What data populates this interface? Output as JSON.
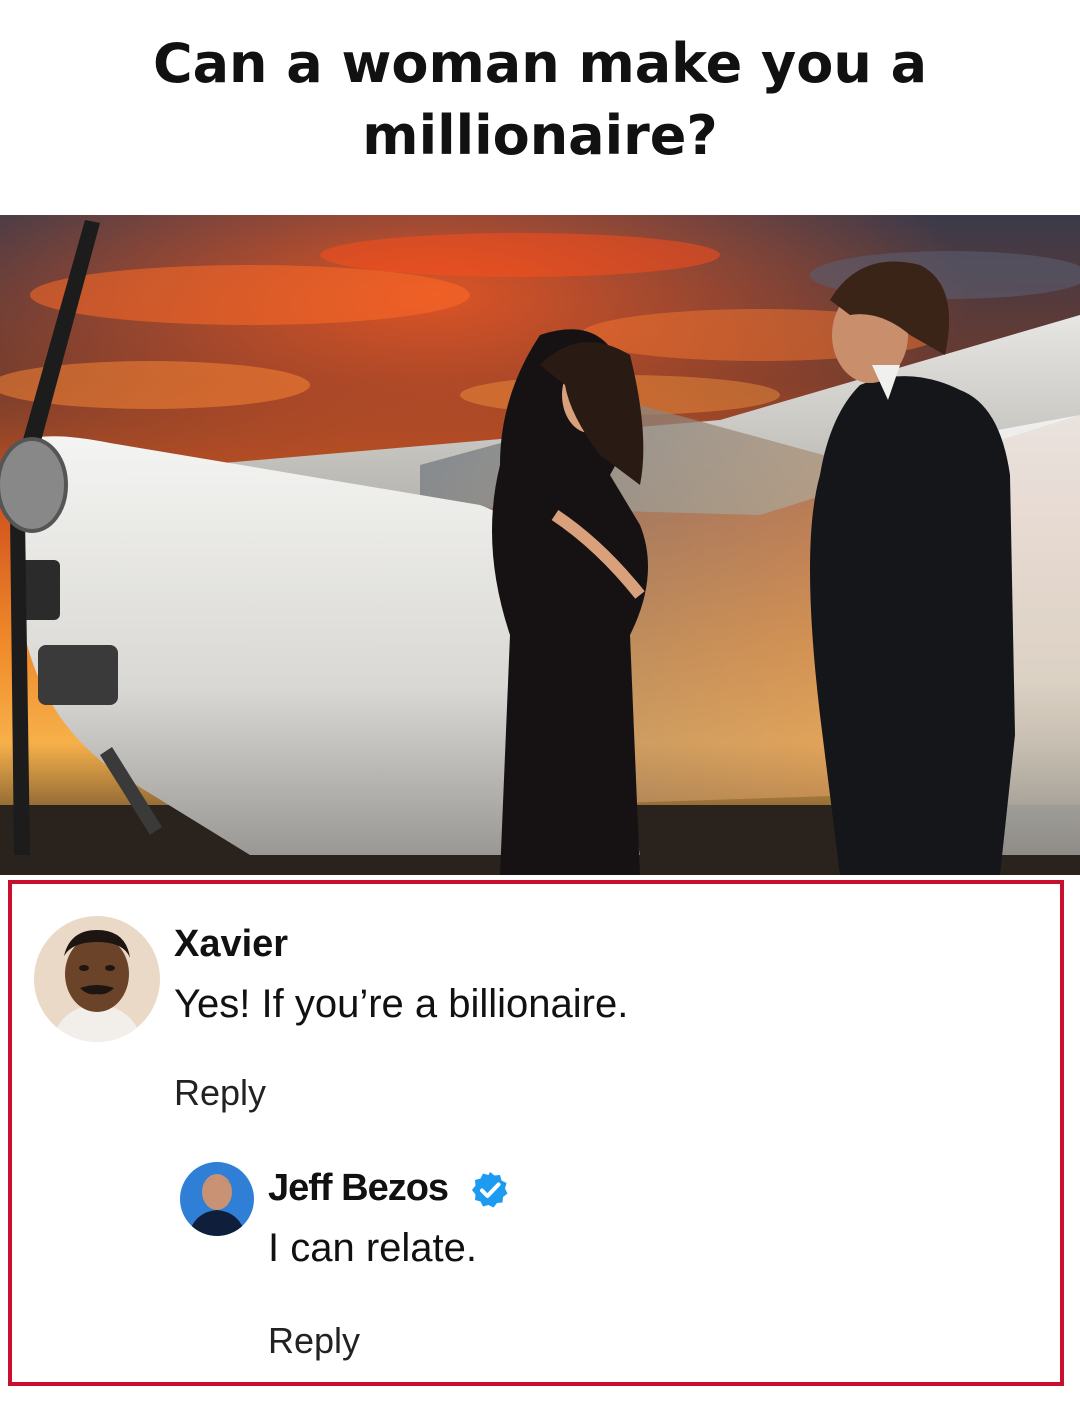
{
  "post": {
    "headline_line1": "Can a woman make you a",
    "headline_line2": "millionaire?"
  },
  "comments": [
    {
      "author": "Xavier",
      "text": "Yes! If you’re a billionaire.",
      "reply_label": "Reply",
      "verified": false
    },
    {
      "author": "Jeff Bezos",
      "text": "I can relate.",
      "reply_label": "Reply",
      "verified": true
    }
  ],
  "colors": {
    "highlight_border": "#c8102e",
    "verified_blue": "#1d9bf0"
  },
  "icons": {
    "verified": "verified-badge-icon"
  }
}
